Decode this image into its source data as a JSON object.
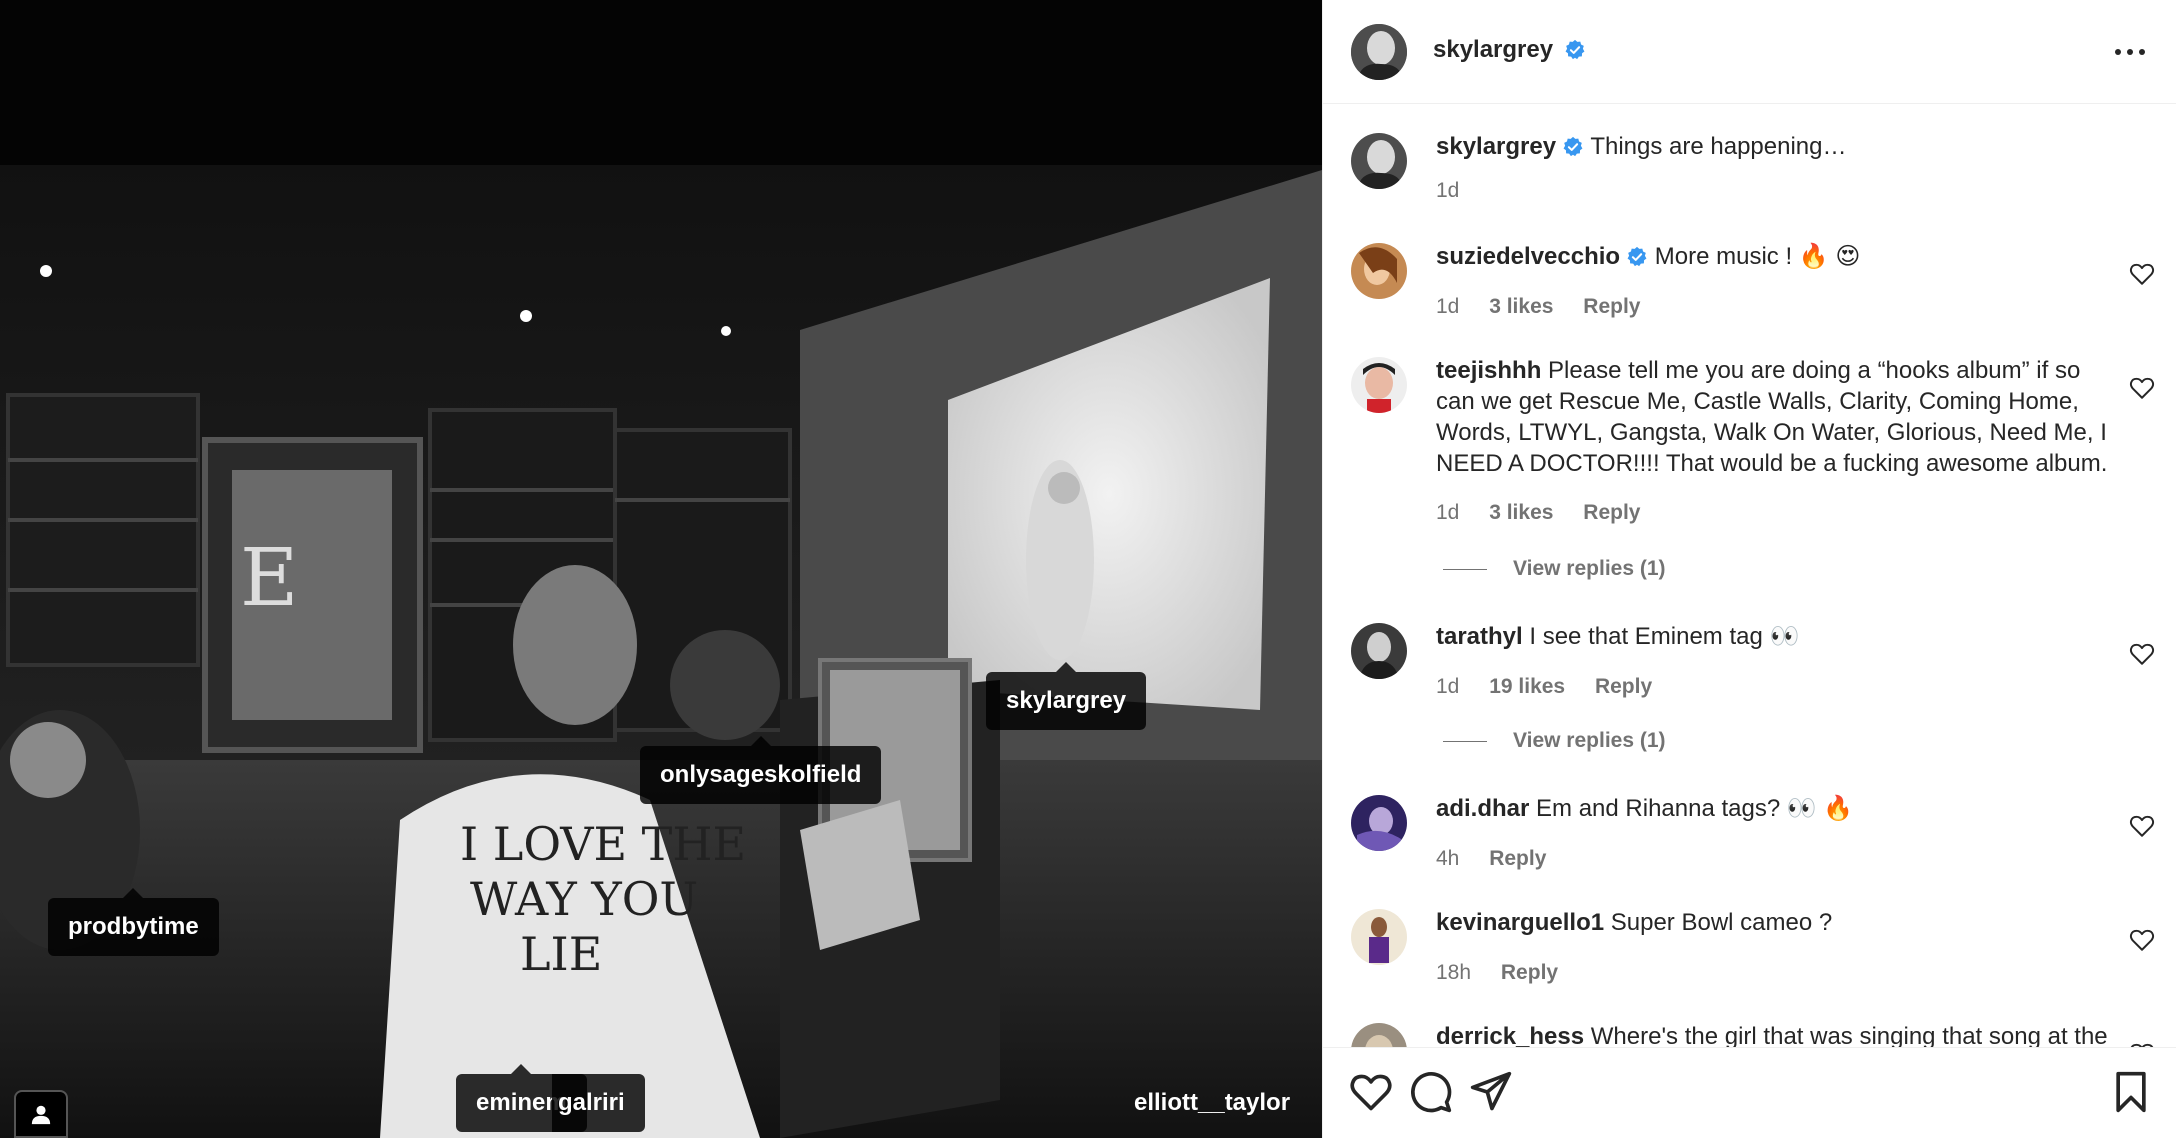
{
  "post": {
    "author": "skylargrey",
    "caption": "Things are happening…",
    "caption_age": "1d"
  },
  "photo_tags": [
    {
      "label": "skylargrey"
    },
    {
      "label": "onlysageskolfield"
    },
    {
      "label": "prodbytime"
    },
    {
      "label": "eminem"
    },
    {
      "label": "galriri"
    },
    {
      "label": "elliott__taylor"
    }
  ],
  "comments": [
    {
      "user": "suziedelvecchio",
      "verified": true,
      "text": "More music ! 🔥 😍",
      "age": "1d",
      "likes": "3 likes",
      "reply": "Reply"
    },
    {
      "user": "teejishhh",
      "verified": false,
      "text": "Please tell me you are doing a “hooks album” if so can we get Rescue Me, Castle Walls, Clarity, Coming Home, Words, LTWYL, Gangsta, Walk On Water, Glorious, Need Me, I NEED A DOCTOR!!!! That would be a fucking awesome album.",
      "age": "1d",
      "likes": "3 likes",
      "reply": "Reply",
      "view_replies": "View replies (1)"
    },
    {
      "user": "tarathyl",
      "verified": false,
      "text": "I see that Eminem tag 👀",
      "age": "1d",
      "likes": "19 likes",
      "reply": "Reply",
      "view_replies": "View replies (1)"
    },
    {
      "user": "adi.dhar",
      "verified": false,
      "text": "Em and Rihanna tags? 👀 🔥",
      "age": "4h",
      "reply": "Reply"
    },
    {
      "user": "kevinarguello1",
      "verified": false,
      "text": "Super Bowl cameo ?",
      "age": "18h",
      "reply": "Reply"
    },
    {
      "user": "derrick_hess",
      "verified": false,
      "text": "Where's the girl that was singing that song at the"
    }
  ],
  "icons": {
    "more": "more-options-icon",
    "verified": "verified-badge-icon",
    "like": "heart-icon",
    "comment": "comment-bubble-icon",
    "share": "paper-plane-icon",
    "save": "bookmark-icon",
    "user_tags": "person-icon"
  },
  "colors": {
    "verified_blue": "#3897f0",
    "meta_gray": "#737373",
    "text": "#262626"
  }
}
